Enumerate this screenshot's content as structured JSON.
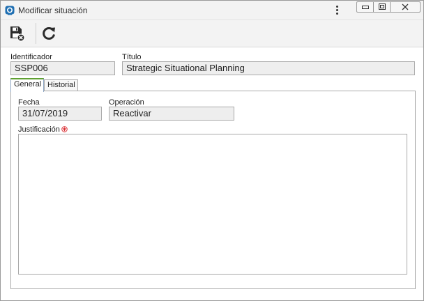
{
  "window": {
    "title": "Modificar situación"
  },
  "toolbar": {
    "save_icon": "save-cancel-icon",
    "refresh_icon": "refresh-icon"
  },
  "fields": {
    "identificador": {
      "label": "Identificador",
      "value": "SSP006"
    },
    "titulo": {
      "label": "Título",
      "value": "Strategic Situational Planning"
    }
  },
  "tabs": [
    {
      "label": "General",
      "active": true
    },
    {
      "label": "Historial",
      "active": false
    }
  ],
  "general": {
    "fecha": {
      "label": "Fecha",
      "value": "31/07/2019"
    },
    "operacion": {
      "label": "Operación",
      "value": "Reactivar"
    },
    "justificacion": {
      "label": "Justificación",
      "value": "",
      "required": true
    }
  },
  "colors": {
    "active_tab_accent": "#5fa032",
    "required_marker": "#d9262b",
    "app_icon": "#1f6fb2"
  }
}
